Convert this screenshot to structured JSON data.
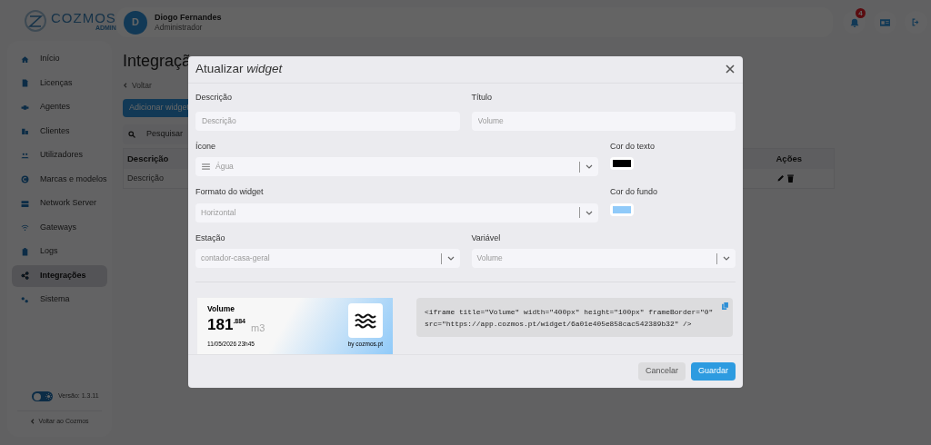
{
  "logo": {
    "name": "COZMOS",
    "sub": "ADMIN"
  },
  "user": {
    "initial": "D",
    "name": "Diogo Fernandes",
    "role": "Administrador"
  },
  "notifications": {
    "count": "4"
  },
  "sidebar": {
    "items": [
      {
        "label": "Início",
        "selected": false
      },
      {
        "label": "Licenças",
        "selected": false
      },
      {
        "label": "Agentes",
        "selected": false
      },
      {
        "label": "Clientes",
        "selected": false
      },
      {
        "label": "Utilizadores",
        "selected": false
      },
      {
        "label": "Marcas e modelos",
        "selected": false
      },
      {
        "label": "Network Server",
        "selected": false
      },
      {
        "label": "Gateways",
        "selected": false
      },
      {
        "label": "Logs",
        "selected": false
      },
      {
        "label": "Integrações",
        "selected": true
      },
      {
        "label": "Sistema",
        "selected": false
      }
    ],
    "theme_toggle": {
      "dark_mode": false
    },
    "version": "Versão: 1.3.11",
    "back": "Voltar ao Cozmos"
  },
  "page": {
    "title": "Integraçã",
    "back": "Voltar",
    "add_button": "Adicionar widget",
    "search_placeholder": "Pesquisar",
    "table": {
      "columns": [
        "Descrição",
        "Ações"
      ],
      "rows": [
        [
          "Descrição"
        ]
      ]
    }
  },
  "modal": {
    "title": "Atualizar *widget*",
    "rows": [
      [
        {
          "label": "Descrição",
          "kind": "text",
          "placeholder": "Descrição"
        },
        {
          "label": "Título",
          "kind": "text",
          "placeholder": "Volume"
        }
      ],
      [
        {
          "label": "Ícone",
          "kind": "icon-select",
          "value": "Água"
        },
        {
          "label": "Cor do texto",
          "kind": "color",
          "color": "#000000"
        }
      ],
      [
        {
          "label": "Formato do widget",
          "kind": "select",
          "value": "Horizontal"
        },
        {
          "label": "Cor do fundo",
          "kind": "color",
          "color": "#90caf9"
        }
      ],
      [
        {
          "label": "Estação",
          "kind": "select",
          "value": "contador-casa-geral"
        },
        {
          "label": "Variável",
          "kind": "select",
          "value": "Volume"
        }
      ]
    ],
    "preview": {
      "title": "Volume",
      "value": "181",
      "decimals": ".884",
      "unit": "m3",
      "timestamp": "11/05/2026 23h45",
      "credit": "by cozmos.pt"
    },
    "embed_code": [
      "<iframe title=\"Volume\" width=\"400px\" height=\"100px\" frameBorder=\"0\"",
      "src=\"https://app.cozmos.pt/widget/6a01e405e858cac542389b32\" />"
    ],
    "buttons": [
      {
        "label": "Cancelar",
        "kind": "secondary"
      },
      {
        "label": "Guardar",
        "kind": "primary"
      }
    ]
  }
}
